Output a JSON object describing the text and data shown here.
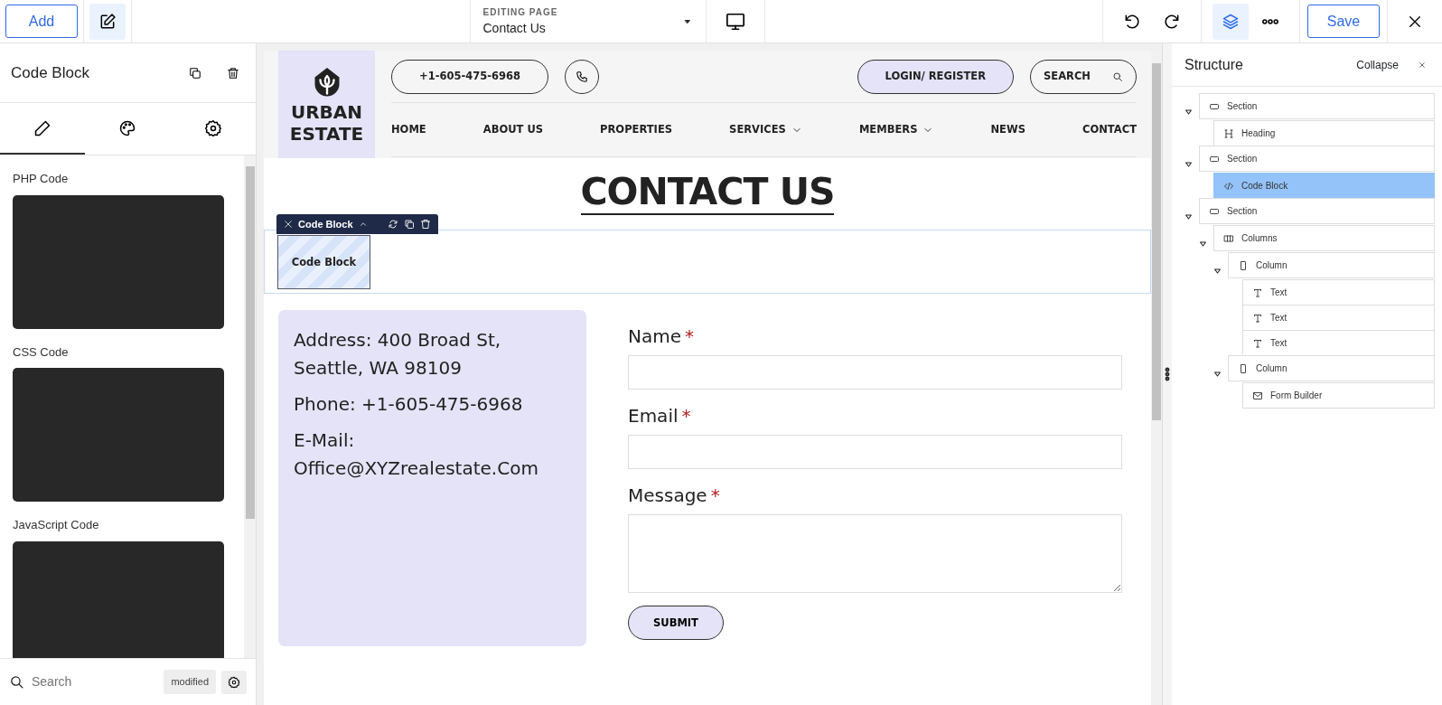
{
  "toolbar": {
    "add_button": "Add",
    "page_picker": {
      "caption": "EDITING PAGE",
      "value": "Contact Us"
    },
    "save_button": "Save"
  },
  "inspector": {
    "title": "Code Block",
    "tabs": [
      {
        "kind": "content",
        "selected": true
      },
      {
        "kind": "style",
        "selected": false
      },
      {
        "kind": "advanced",
        "selected": false
      }
    ],
    "code_fields": [
      {
        "label": "PHP Code"
      },
      {
        "label": "CSS Code"
      },
      {
        "label": "JavaScript Code"
      }
    ],
    "search": {
      "placeholder": "Search"
    },
    "filter_tag": "modified"
  },
  "preview": {
    "logo_lines": [
      "URBAN",
      "ESTATE"
    ],
    "phone_button": "+1-605-475-6968",
    "login_button": "LOGIN/ REGISTER",
    "search_button": "SEARCH",
    "nav": [
      {
        "label": "HOME",
        "has_menu": false
      },
      {
        "label": "ABOUT US",
        "has_menu": false
      },
      {
        "label": "PROPERTIES",
        "has_menu": false
      },
      {
        "label": "SERVICES",
        "has_menu": true
      },
      {
        "label": "MEMBERS",
        "has_menu": true
      },
      {
        "label": "NEWS",
        "has_menu": false
      },
      {
        "label": "CONTACT",
        "has_menu": false
      }
    ],
    "heading": "CONTACT US",
    "code_block": {
      "toolbar_label": "Code Block",
      "label": "Code Block"
    },
    "contact_lines": [
      "Address: 400 Broad St, Seattle, WA 98109",
      "Phone: +1-605-475-6968",
      "E-Mail: Office@XYZrealestate.Com"
    ],
    "form": {
      "fields": [
        {
          "label": "Name",
          "marker": "*",
          "kind": "input"
        },
        {
          "label": "Email",
          "marker": "*",
          "kind": "input"
        },
        {
          "label": "Message",
          "marker": "*",
          "kind": "textarea"
        }
      ],
      "submit": "SUBMIT"
    }
  },
  "structure": {
    "title": "Structure",
    "collapse_link": "Collapse",
    "tree": [
      {
        "label": "Section",
        "kind": "section",
        "expanded": true,
        "selected": false,
        "children": [
          {
            "label": "Heading",
            "kind": "heading",
            "selected": false
          }
        ]
      },
      {
        "label": "Section",
        "kind": "section",
        "expanded": true,
        "selected": false,
        "children": [
          {
            "label": "Code Block",
            "kind": "code",
            "selected": true
          }
        ]
      },
      {
        "label": "Section",
        "kind": "section",
        "expanded": true,
        "selected": false,
        "children": [
          {
            "label": "Columns",
            "kind": "columns",
            "expanded": true,
            "selected": false,
            "children": [
              {
                "label": "Column",
                "kind": "column",
                "expanded": true,
                "selected": false,
                "children": [
                  {
                    "label": "Text",
                    "kind": "text",
                    "selected": false
                  },
                  {
                    "label": "Text",
                    "kind": "text",
                    "selected": false
                  },
                  {
                    "label": "Text",
                    "kind": "text",
                    "selected": false
                  }
                ]
              },
              {
                "label": "Column",
                "kind": "column",
                "expanded": true,
                "selected": false,
                "children": [
                  {
                    "label": "Form Builder",
                    "kind": "form",
                    "selected": false
                  }
                ]
              }
            ]
          }
        ]
      }
    ]
  }
}
